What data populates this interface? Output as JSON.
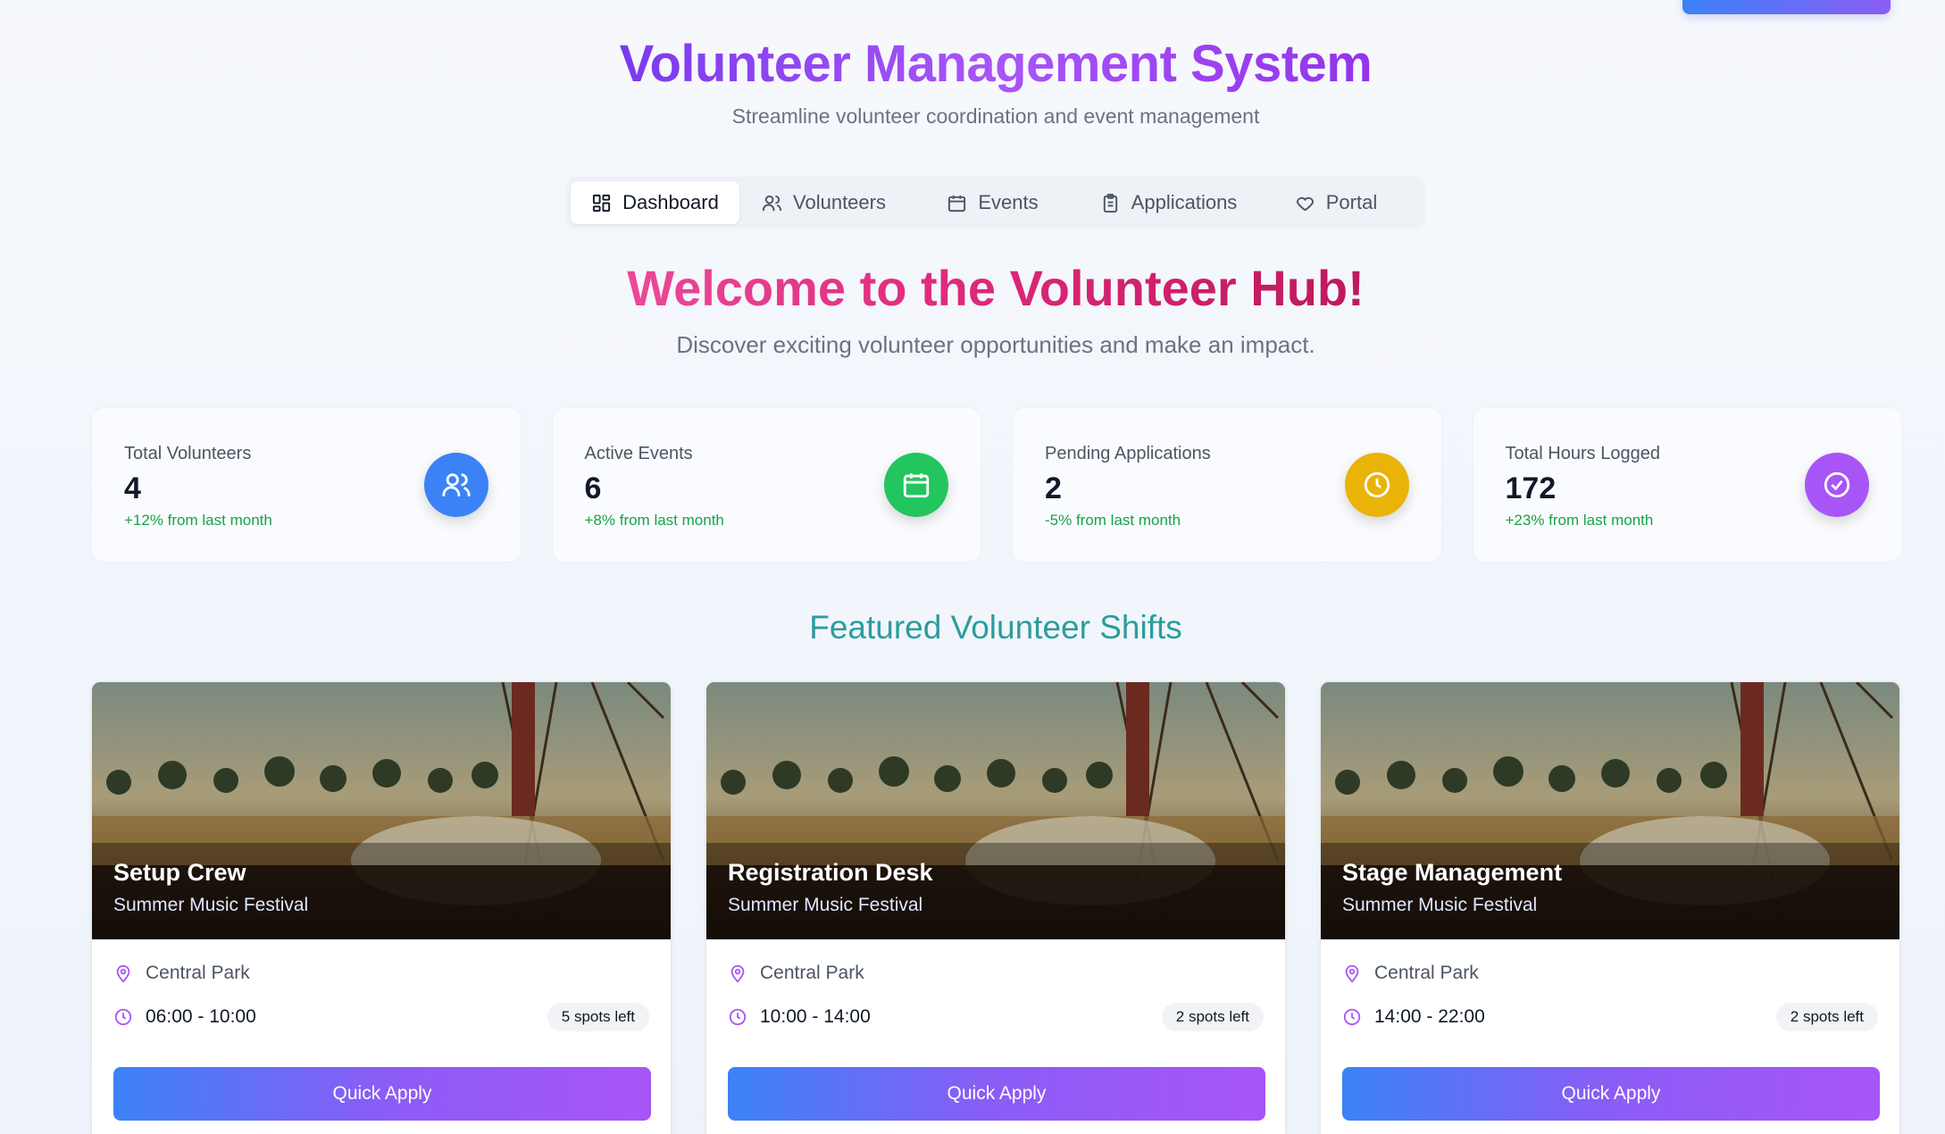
{
  "header": {
    "title": "Volunteer Management System",
    "subtitle": "Streamline volunteer coordination and event management"
  },
  "tabs": [
    {
      "label": "Dashboard",
      "icon": "dashboard-grid-icon",
      "active": true
    },
    {
      "label": "Volunteers",
      "icon": "users-icon",
      "active": false
    },
    {
      "label": "Events",
      "icon": "calendar-icon",
      "active": false
    },
    {
      "label": "Applications",
      "icon": "clipboard-icon",
      "active": false
    },
    {
      "label": "Portal",
      "icon": "heart-icon",
      "active": false
    }
  ],
  "welcome": {
    "title": "Welcome to the Volunteer Hub!",
    "subtitle": "Discover exciting volunteer opportunities and make an impact."
  },
  "stats": [
    {
      "label": "Total Volunteers",
      "value": "4",
      "change": "+12% from last month",
      "icon": "users-icon",
      "color": "#3b82f6"
    },
    {
      "label": "Active Events",
      "value": "6",
      "change": "+8% from last month",
      "icon": "calendar-icon",
      "color": "#22c55e"
    },
    {
      "label": "Pending Applications",
      "value": "2",
      "change": "-5% from last month",
      "icon": "clock-icon",
      "color": "#eab308"
    },
    {
      "label": "Total Hours Logged",
      "value": "172",
      "change": "+23% from last month",
      "icon": "check-circle-icon",
      "color": "#a855f7"
    }
  ],
  "featured": {
    "title": "Featured Volunteer Shifts",
    "shifts": [
      {
        "title": "Setup Crew",
        "event": "Summer Music Festival",
        "location": "Central Park",
        "time": "06:00 - 10:00",
        "spots": "5 spots left",
        "button": "Quick Apply"
      },
      {
        "title": "Registration Desk",
        "event": "Summer Music Festival",
        "location": "Central Park",
        "time": "10:00 - 14:00",
        "spots": "2 spots left",
        "button": "Quick Apply"
      },
      {
        "title": "Stage Management",
        "event": "Summer Music Festival",
        "location": "Central Park",
        "time": "14:00 - 22:00",
        "spots": "2 spots left",
        "button": "Quick Apply"
      }
    ]
  },
  "colors": {
    "accent_blue": "#3b82f6",
    "accent_purple": "#a855f7",
    "section_teal": "#2a9d9d",
    "positive_green": "#16a34a"
  }
}
